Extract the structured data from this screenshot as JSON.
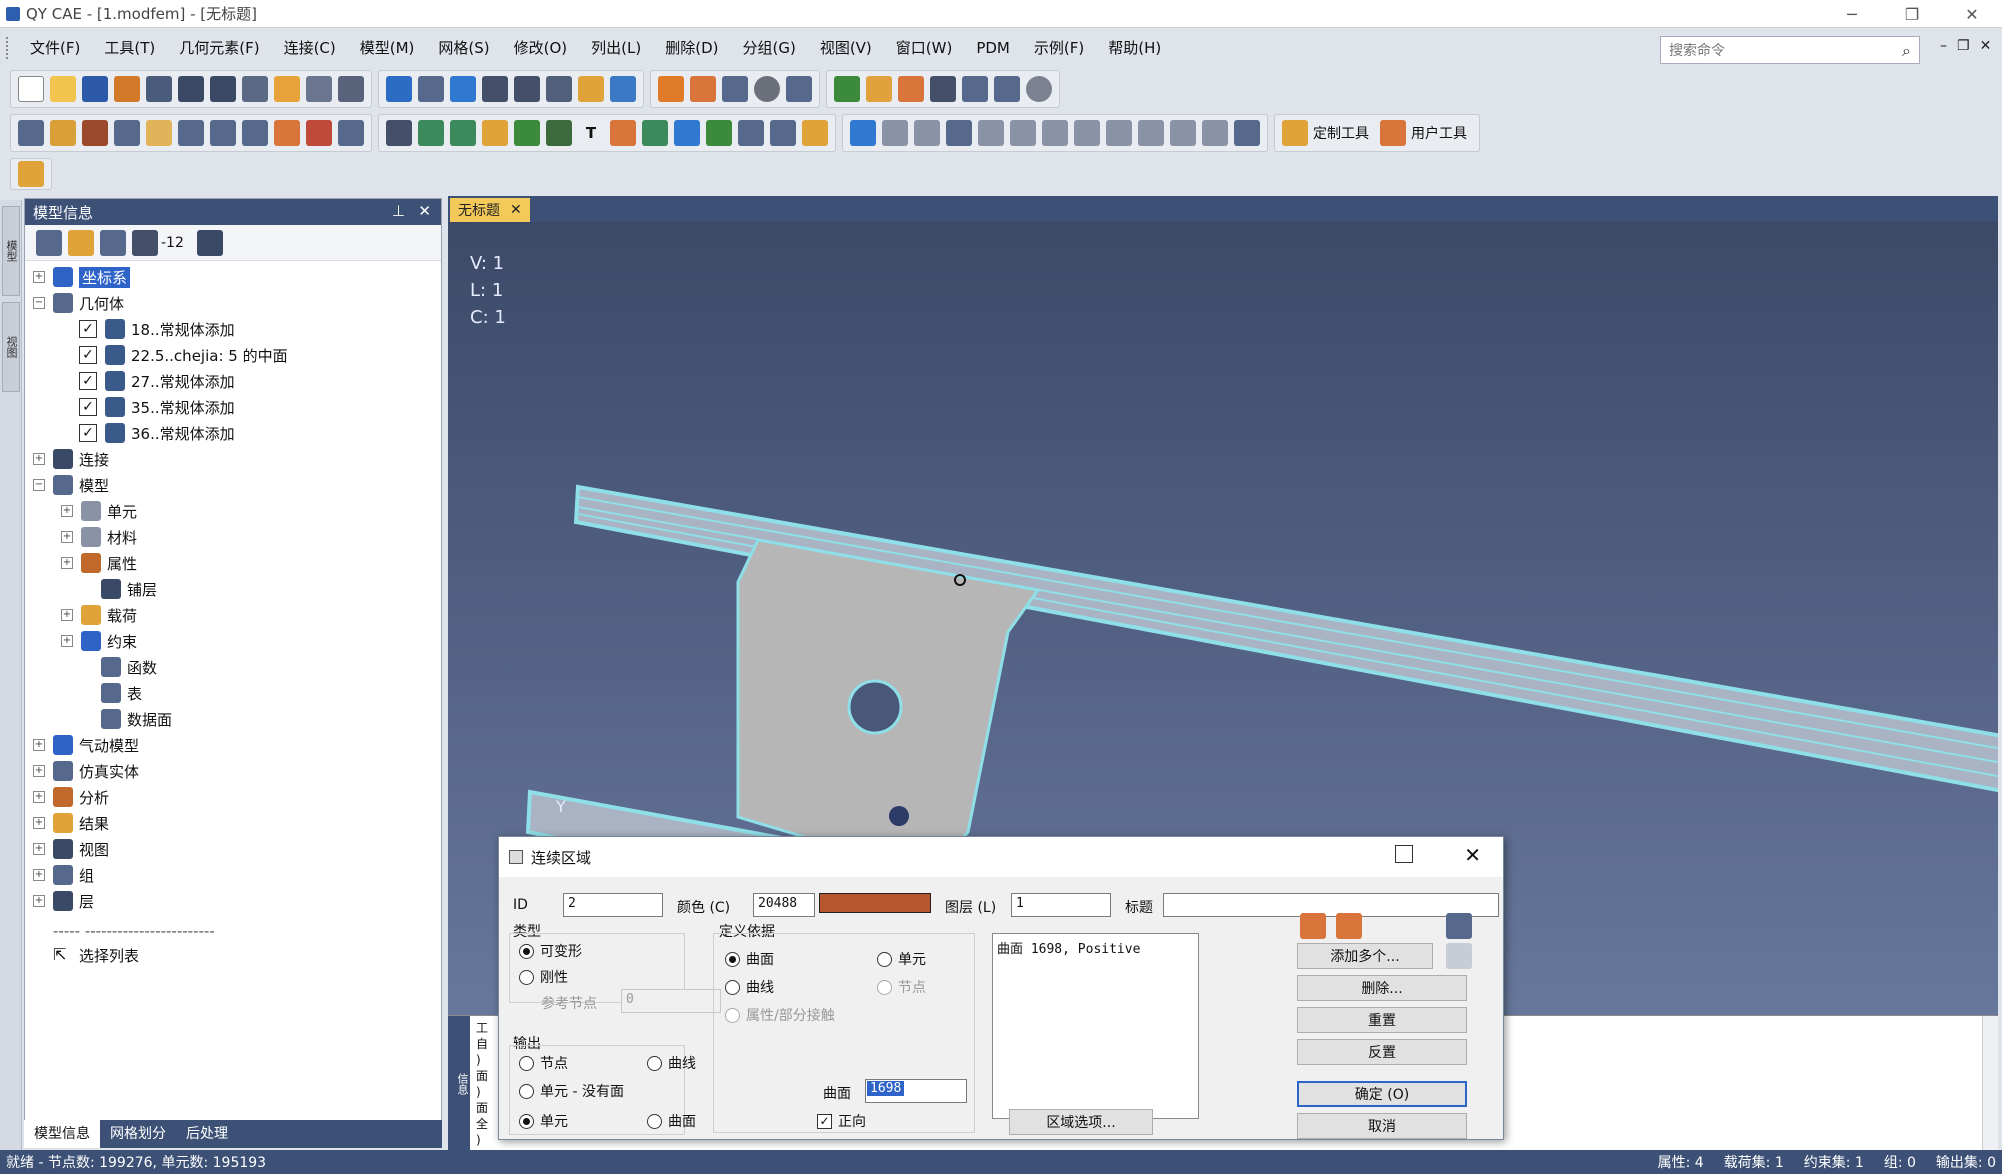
{
  "window": {
    "title": "QY CAE - [1.modfem] - [无标题]",
    "min": "─",
    "restore": "❐",
    "close": "✕"
  },
  "menu": [
    "文件(F)",
    "工具(T)",
    "几何元素(F)",
    "连接(C)",
    "模型(M)",
    "网格(S)",
    "修改(O)",
    "列出(L)",
    "删除(D)",
    "分组(G)",
    "视图(V)",
    "窗口(W)",
    "PDM",
    "示例(F)",
    "帮助(H)"
  ],
  "search": {
    "placeholder": "搜索命令"
  },
  "toolbar": {
    "custom_tools": "定制工具",
    "user_tools": "用户工具"
  },
  "left_strip_tabs": [
    "模型",
    "视图"
  ],
  "panel": {
    "title": "模型信息",
    "tool_value": "-12",
    "tree": {
      "coord": "坐标系",
      "geometry": "几何体",
      "geo_items": [
        "18..常规体添加",
        "22.5..chejia: 5 的中面",
        "27..常规体添加",
        "35..常规体添加",
        "36..常规体添加"
      ],
      "connections": "连接",
      "model": "模型",
      "model_items": [
        "单元",
        "材料",
        "属性",
        "铺层",
        "载荷",
        "约束",
        "函数",
        "表",
        "数据面"
      ],
      "aero": "气动模型",
      "sim": "仿真实体",
      "analysis": "分析",
      "results": "结果",
      "views": "视图",
      "groups": "组",
      "layers": "层",
      "dashes": "----- ------------------------",
      "selection": "选择列表"
    },
    "tabs": [
      "模型信息",
      "网格划分",
      "后处理"
    ]
  },
  "doc_tab": "无标题",
  "viewport": {
    "v": "V: 1",
    "l": "L: 1",
    "c": "C: 1",
    "axis_y": "Y"
  },
  "output_side": "信息",
  "output_lines": [
    "工",
    "自",
    ")",
    "面",
    ")",
    "面",
    "全",
    ")"
  ],
  "status": {
    "left": "就绪 - 节点数: 199276, 单元数: 195193",
    "right": [
      "属性: 4",
      "载荷集: 1",
      "约束集: 1",
      "组: 0",
      "输出集: 0"
    ]
  },
  "dialog": {
    "title": "连续区域",
    "id_label": "ID",
    "id_value": "2",
    "color_label": "颜色 (C)",
    "color_value": "20488",
    "color_hex": "#b5562f",
    "layer_label": "图层 (L)",
    "layer_value": "1",
    "title_label": "标题",
    "title_value": "",
    "type_label": "类型",
    "deformable": "可变形",
    "rigid": "刚性",
    "ref_node": "参考节点",
    "ref_node_value": "0",
    "output_label": "输出",
    "out_node": "节点",
    "out_curve": "曲线",
    "out_elem_no_face": "单元 - 没有面",
    "out_elem": "单元",
    "out_face": "曲面",
    "define_label": "定义依据",
    "def_surface": "曲面",
    "def_element": "单元",
    "def_curve": "曲线",
    "def_node": "节点",
    "def_prop": "属性/部分接触",
    "surface_label": "曲面",
    "surface_value": "1698",
    "positive": "正向",
    "list_item": "曲面 1698, Positive",
    "region_options": "区域选项...",
    "btn_add_multi": "添加多个...",
    "btn_delete": "删除...",
    "btn_reset": "重置",
    "btn_reverse": "反置",
    "btn_ok": "确定 (O)",
    "btn_cancel": "取消"
  }
}
